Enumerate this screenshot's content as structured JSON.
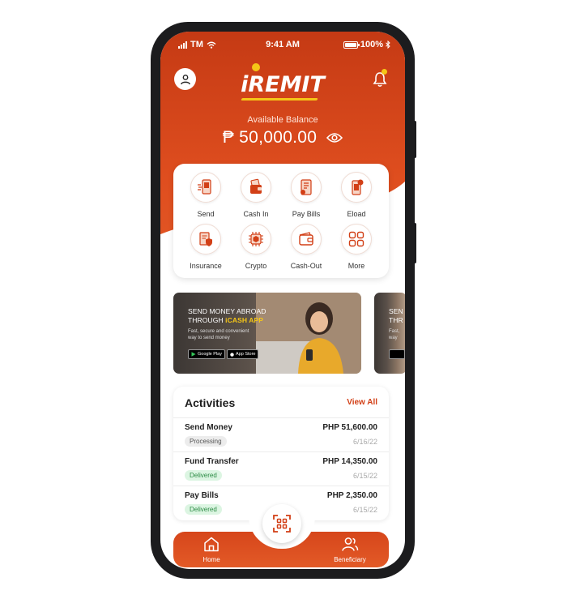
{
  "status_bar": {
    "carrier": "TM",
    "time": "9:41 AM",
    "battery": "100%"
  },
  "header": {
    "brand": "iREMIT"
  },
  "balance": {
    "label": "Available Balance",
    "amount": "₱ 50,000.00"
  },
  "actions": [
    {
      "label": "Send",
      "icon": "send-money-icon"
    },
    {
      "label": "Cash In",
      "icon": "wallet-cash-in-icon"
    },
    {
      "label": "Pay Bills",
      "icon": "bill-icon"
    },
    {
      "label": "Eload",
      "icon": "phone-load-icon"
    },
    {
      "label": "Insurance",
      "icon": "insurance-shield-icon"
    },
    {
      "label": "Crypto",
      "icon": "crypto-chip-icon"
    },
    {
      "label": "Cash-Out",
      "icon": "wallet-icon"
    },
    {
      "label": "More",
      "icon": "grid-icon"
    }
  ],
  "banner": {
    "line1_prefix": "SEND MONEY ABROAD",
    "line2_prefix": "THROUGH ",
    "line2_highlight": "iCASH APP",
    "subtitle_line1": "Fast, secure and convenient",
    "subtitle_line2": "way to send money",
    "google_play": "Google Play",
    "app_store": "App Store",
    "peek_line1": "SEN",
    "peek_line2": "THR",
    "peek_sub1": "Fast,",
    "peek_sub2": "way"
  },
  "activities": {
    "title": "Activities",
    "view_all": "View All",
    "items": [
      {
        "name": "Send Money",
        "amount": "PHP 51,600.00",
        "status": "Processing",
        "date": "6/16/22"
      },
      {
        "name": "Fund Transfer",
        "amount": "PHP 14,350.00",
        "status": "Delivered",
        "date": "6/15/22"
      },
      {
        "name": "Pay Bills",
        "amount": "PHP 2,350.00",
        "status": "Delivered",
        "date": "6/15/22"
      }
    ]
  },
  "nav": {
    "home": "Home",
    "beneficiary": "Beneficiary"
  },
  "colors": {
    "brand": "#d6461b",
    "accent": "#f5c617",
    "delivered": "#2a8a43"
  }
}
